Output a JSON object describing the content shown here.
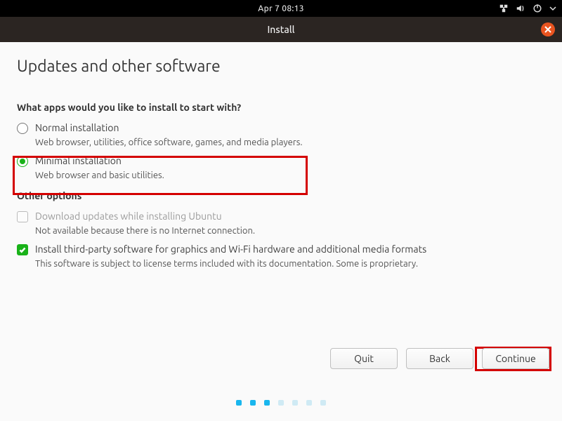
{
  "panel": {
    "clock": "Apr 7  08:13"
  },
  "titlebar": {
    "title": "Install"
  },
  "page": {
    "heading": "Updates and other software",
    "apps_question": "What apps would you like to install to start with?",
    "normal": {
      "label": "Normal installation",
      "desc": "Web browser, utilities, office software, games, and media players."
    },
    "minimal": {
      "label": "Minimal installation",
      "desc": "Web browser and basic utilities."
    },
    "other_options_label": "Other options",
    "download_updates": {
      "label": "Download updates while installing Ubuntu",
      "desc": "Not available because there is no Internet connection."
    },
    "third_party": {
      "label": "Install third-party software for graphics and Wi-Fi hardware and additional media formats",
      "desc": "This software is subject to license terms included with its documentation. Some is proprietary."
    }
  },
  "buttons": {
    "quit": "Quit",
    "back": "Back",
    "continue": "Continue"
  }
}
